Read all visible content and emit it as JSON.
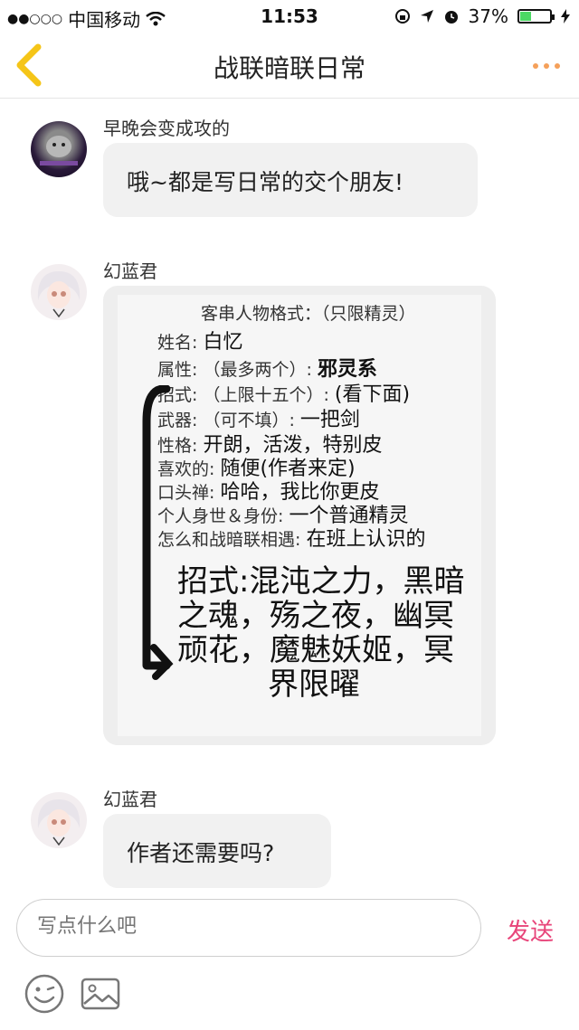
{
  "status_bar": {
    "carrier": "中国移动",
    "time": "11:53",
    "battery": "37%",
    "battery_level": 0.37
  },
  "nav": {
    "title": "战联暗联日常",
    "back_icon": "chevron-left-icon",
    "more_icon": "more-dots-icon",
    "accent": "#f5c518",
    "more_color": "#f5a05a"
  },
  "messages": [
    {
      "sender": "早晚会变成攻的",
      "text": "哦~都是写日常的交个朋友!"
    },
    {
      "sender": "幻蓝君",
      "image": {
        "header": "客串人物格式：（只限精灵）",
        "fields": [
          {
            "label": "姓名:",
            "value": "白忆"
          },
          {
            "label": "属性: （最多两个）:",
            "value": "邪灵系"
          },
          {
            "label": "招式: （上限十五个）:",
            "value": "(看下面)"
          },
          {
            "label": "武器: （可不填）:",
            "value": "一把剑"
          },
          {
            "label": "性格:",
            "value": "开朗，活泼，特别皮"
          },
          {
            "label": "喜欢的:",
            "value": "随便(作者来定)"
          },
          {
            "label": "口头禅:",
            "value": "哈哈，我比你更皮"
          },
          {
            "label": "个人身世＆身份:",
            "value": "一个普通精灵"
          },
          {
            "label": "怎么和战暗联相遇:",
            "value": "在班上认识的"
          }
        ],
        "moves_lines": [
          "招式:混沌之力，黑暗",
          "之魂，殇之夜，幽冥",
          "顽花，魔魅妖姬，冥",
          "界限曜"
        ]
      }
    },
    {
      "sender": "幻蓝君",
      "text": "作者还需要吗?"
    }
  ],
  "input_bar": {
    "placeholder": "写点什么吧",
    "send_label": "发送",
    "send_color": "#e8457a",
    "emoji_icon": "emoji-icon",
    "image_icon": "image-icon"
  }
}
